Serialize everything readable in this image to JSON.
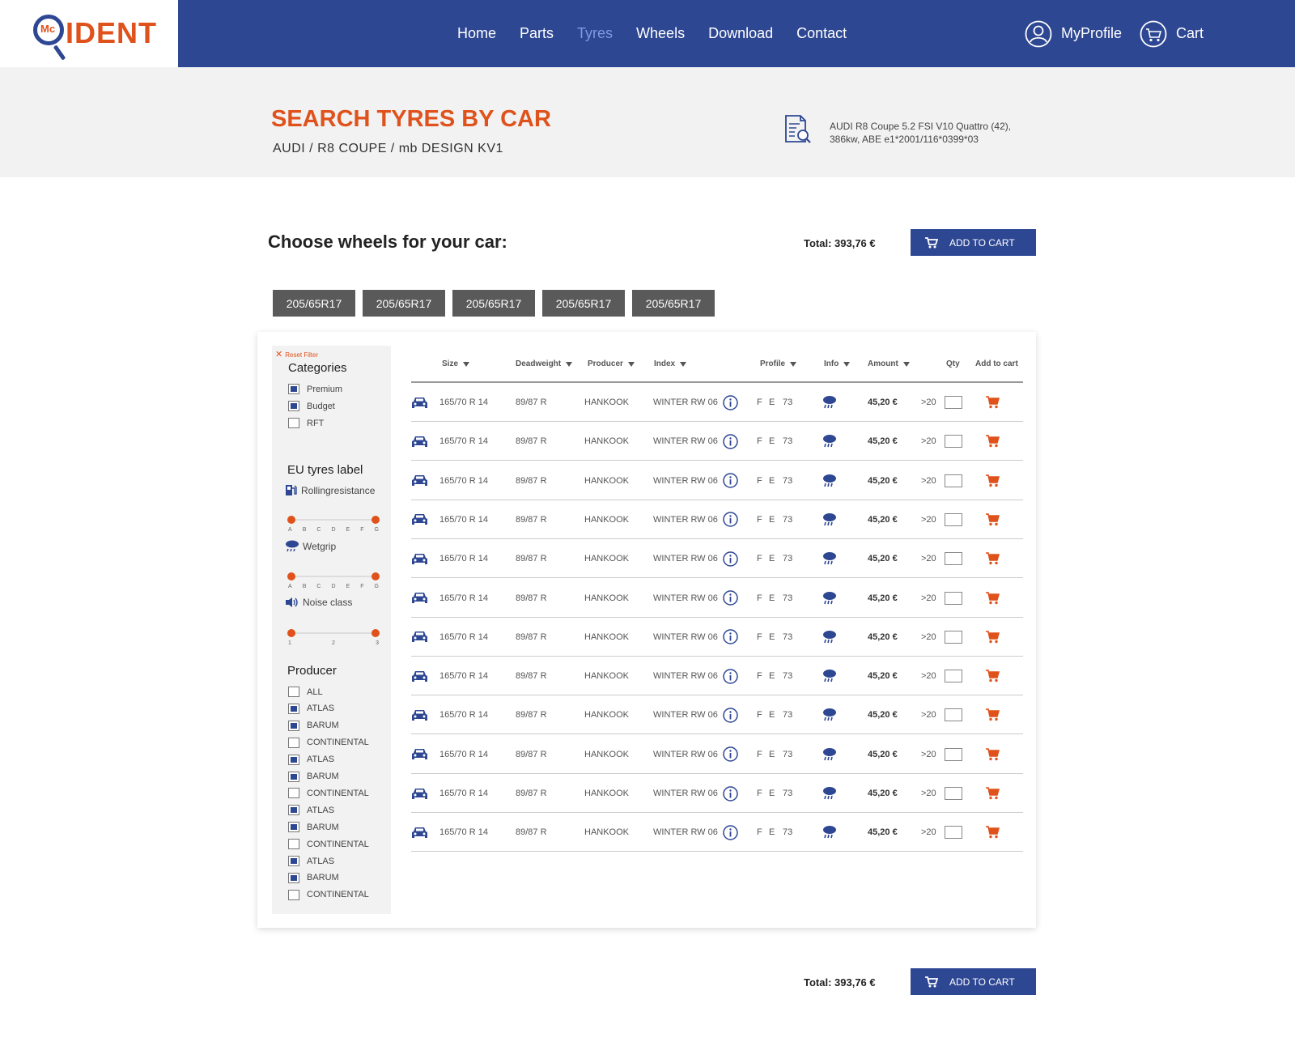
{
  "brand": {
    "mc": "Mc",
    "name": "IDENT"
  },
  "nav": [
    {
      "label": "Home",
      "active": false
    },
    {
      "label": "Parts",
      "active": false
    },
    {
      "label": "Tyres",
      "active": true
    },
    {
      "label": "Wheels",
      "active": false
    },
    {
      "label": "Download",
      "active": false
    },
    {
      "label": "Contact",
      "active": false
    }
  ],
  "user": {
    "profile": "MyProfile",
    "cart": "Cart"
  },
  "banner": {
    "title": "SEARCH TYRES BY CAR",
    "subtitle": "AUDI / R8 COUPE / mb DESIGN KV1",
    "car_line1": "AUDI R8 Coupe 5.2 FSI V10 Quattro (42),",
    "car_line2": "386kw, ABE e1*2001/116*0399*03"
  },
  "choose": {
    "title": "Choose wheels for your car:",
    "total": "Total: 393,76 €",
    "add_to_cart": "ADD TO CART"
  },
  "size_tabs": [
    "205/65R17",
    "205/65R17",
    "205/65R17",
    "205/65R17",
    "205/65R17"
  ],
  "filters": {
    "reset": "Reset Filter",
    "categories_title": "Categories",
    "categories": [
      {
        "label": "Premium",
        "checked": true
      },
      {
        "label": "Budget",
        "checked": true
      },
      {
        "label": "RFT",
        "checked": false
      }
    ],
    "eu_title": "EU tyres label",
    "rolling": "Rollingresistance",
    "wetgrip": "Wetgrip",
    "noise": "Noise class",
    "grade_ticks": [
      "A",
      "B",
      "C",
      "D",
      "E",
      "F",
      "G"
    ],
    "noise_ticks": [
      "1",
      "2",
      "3"
    ],
    "producer_title": "Producer",
    "producers": [
      {
        "label": "ALL",
        "checked": false
      },
      {
        "label": "ATLAS",
        "checked": true
      },
      {
        "label": "BARUM",
        "checked": true
      },
      {
        "label": "CONTINENTAL",
        "checked": false
      },
      {
        "label": "ATLAS",
        "checked": true
      },
      {
        "label": "BARUM",
        "checked": true
      },
      {
        "label": "CONTINENTAL",
        "checked": false
      },
      {
        "label": "ATLAS",
        "checked": true
      },
      {
        "label": "BARUM",
        "checked": true
      },
      {
        "label": "CONTINENTAL",
        "checked": false
      },
      {
        "label": "ATLAS",
        "checked": true
      },
      {
        "label": "BARUM",
        "checked": true
      },
      {
        "label": "CONTINENTAL",
        "checked": false
      }
    ]
  },
  "table": {
    "headers": {
      "size": "Size",
      "deadweight": "Deadweight",
      "producer": "Producer",
      "index": "Index",
      "profile": "Profile",
      "info": "Info",
      "amount": "Amount",
      "qty": "Qty",
      "add": "Add to cart"
    },
    "rows": [
      {
        "size": "165/70 R 14",
        "deadweight": "89/87 R",
        "producer": "HANKOOK",
        "index": "WINTER RW 06",
        "p1": "F",
        "p2": "E",
        "p3": "73",
        "amount": "45,20 €",
        "stock": ">20"
      },
      {
        "size": "165/70 R 14",
        "deadweight": "89/87 R",
        "producer": "HANKOOK",
        "index": "WINTER RW 06",
        "p1": "F",
        "p2": "E",
        "p3": "73",
        "amount": "45,20 €",
        "stock": ">20"
      },
      {
        "size": "165/70 R 14",
        "deadweight": "89/87 R",
        "producer": "HANKOOK",
        "index": "WINTER RW 06",
        "p1": "F",
        "p2": "E",
        "p3": "73",
        "amount": "45,20 €",
        "stock": ">20"
      },
      {
        "size": "165/70 R 14",
        "deadweight": "89/87 R",
        "producer": "HANKOOK",
        "index": "WINTER RW 06",
        "p1": "F",
        "p2": "E",
        "p3": "73",
        "amount": "45,20 €",
        "stock": ">20"
      },
      {
        "size": "165/70 R 14",
        "deadweight": "89/87 R",
        "producer": "HANKOOK",
        "index": "WINTER RW 06",
        "p1": "F",
        "p2": "E",
        "p3": "73",
        "amount": "45,20 €",
        "stock": ">20"
      },
      {
        "size": "165/70 R 14",
        "deadweight": "89/87 R",
        "producer": "HANKOOK",
        "index": "WINTER RW 06",
        "p1": "F",
        "p2": "E",
        "p3": "73",
        "amount": "45,20 €",
        "stock": ">20"
      },
      {
        "size": "165/70 R 14",
        "deadweight": "89/87 R",
        "producer": "HANKOOK",
        "index": "WINTER RW 06",
        "p1": "F",
        "p2": "E",
        "p3": "73",
        "amount": "45,20 €",
        "stock": ">20"
      },
      {
        "size": "165/70 R 14",
        "deadweight": "89/87 R",
        "producer": "HANKOOK",
        "index": "WINTER RW 06",
        "p1": "F",
        "p2": "E",
        "p3": "73",
        "amount": "45,20 €",
        "stock": ">20"
      },
      {
        "size": "165/70 R 14",
        "deadweight": "89/87 R",
        "producer": "HANKOOK",
        "index": "WINTER RW 06",
        "p1": "F",
        "p2": "E",
        "p3": "73",
        "amount": "45,20 €",
        "stock": ">20"
      },
      {
        "size": "165/70 R 14",
        "deadweight": "89/87 R",
        "producer": "HANKOOK",
        "index": "WINTER RW 06",
        "p1": "F",
        "p2": "E",
        "p3": "73",
        "amount": "45,20 €",
        "stock": ">20"
      },
      {
        "size": "165/70 R 14",
        "deadweight": "89/87 R",
        "producer": "HANKOOK",
        "index": "WINTER RW 06",
        "p1": "F",
        "p2": "E",
        "p3": "73",
        "amount": "45,20 €",
        "stock": ">20"
      },
      {
        "size": "165/70 R 14",
        "deadweight": "89/87 R",
        "producer": "HANKOOK",
        "index": "WINTER RW 06",
        "p1": "F",
        "p2": "E",
        "p3": "73",
        "amount": "45,20 €",
        "stock": ">20"
      }
    ]
  },
  "icons": {
    "row_vehicle": "car-icon",
    "index_info": "info-circle-icon",
    "info_weather": "rain-cloud-icon",
    "row_cart": "cart-icon"
  },
  "colors": {
    "brand_blue": "#2e4793",
    "accent_orange": "#e0521b",
    "tab_grey": "#5a5a5a"
  }
}
